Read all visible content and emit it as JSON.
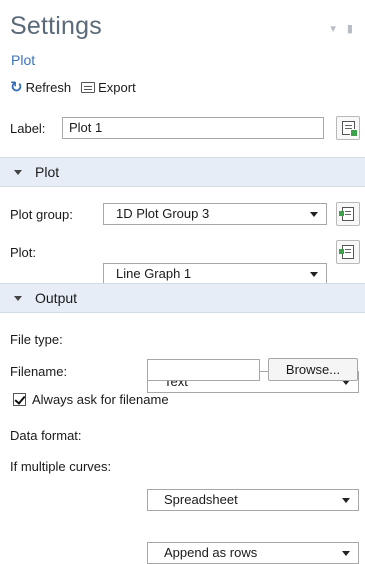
{
  "header": {
    "title": "Settings",
    "subtitle": "Plot"
  },
  "toolbar": {
    "refresh_label": "Refresh",
    "export_label": "Export"
  },
  "label_field": {
    "label": "Label:",
    "value": "Plot 1"
  },
  "sections": {
    "plot": "Plot",
    "output": "Output"
  },
  "plot": {
    "plot_group_label": "Plot group:",
    "plot_group_value": "1D Plot Group 3",
    "plot_label": "Plot:",
    "plot_value": "Line Graph 1"
  },
  "output": {
    "file_type_label": "File type:",
    "file_type_value": "Text",
    "filename_label": "Filename:",
    "filename_value": "",
    "browse_label": "Browse...",
    "always_ask_label": "Always ask for filename",
    "always_ask_checked": true,
    "data_format_label": "Data format:",
    "data_format_value": "Spreadsheet",
    "multi_curves_label": "If multiple curves:",
    "multi_curves_value": "Append as rows"
  },
  "icons": {
    "refresh": "refresh-icon",
    "export": "export-icon",
    "label_edit": "label-edit-icon",
    "go_to_source": "go-to-source-icon",
    "pin": "pin-icon"
  },
  "colors": {
    "title": "#5a6a78",
    "subtitle": "#3d73b6",
    "section_bg": "#e6edf6",
    "accent_green": "#3ba14b"
  }
}
